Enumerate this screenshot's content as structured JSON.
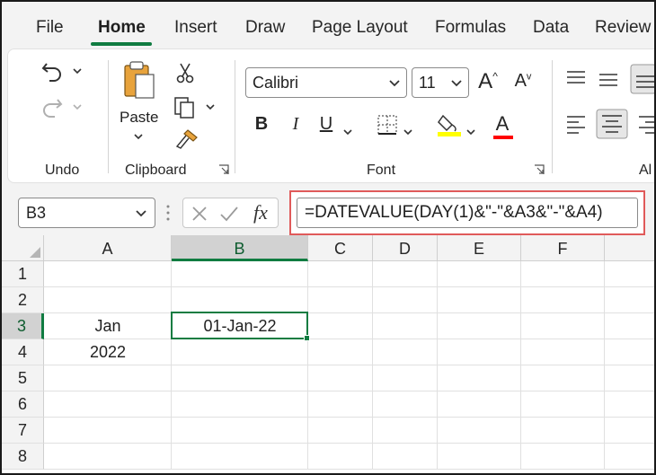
{
  "tabs": [
    "File",
    "Home",
    "Insert",
    "Draw",
    "Page Layout",
    "Formulas",
    "Data",
    "Review"
  ],
  "active_tab": "Home",
  "ribbon": {
    "groups": {
      "undo": "Undo",
      "clipboard": "Clipboard",
      "font": "Font",
      "alignment": "Al"
    },
    "paste_label": "Paste",
    "font_name": "Calibri",
    "font_size": "11",
    "grow_font": "A",
    "shrink_font": "A",
    "bold": "B",
    "italic": "I",
    "underline": "U",
    "font_color": "A",
    "highlight_color": "#ffff00",
    "font_color_bar": "#ff0000"
  },
  "formula_bar": {
    "name_box": "B3",
    "fx_label": "fx",
    "formula": "=DATEVALUE(DAY(1)&\"-\"&A3&\"-\"&A4)"
  },
  "sheet": {
    "columns": [
      "A",
      "B",
      "C",
      "D",
      "E",
      "F"
    ],
    "rows": [
      "1",
      "2",
      "3",
      "4",
      "5",
      "6",
      "7",
      "8"
    ],
    "selected_column": "B",
    "selected_row": "3",
    "cells": {
      "A3": "Jan",
      "A4": "2022",
      "B3": "01-Jan-22"
    }
  },
  "colors": {
    "accent": "#107c41",
    "highlight_box": "#e05a5a"
  }
}
